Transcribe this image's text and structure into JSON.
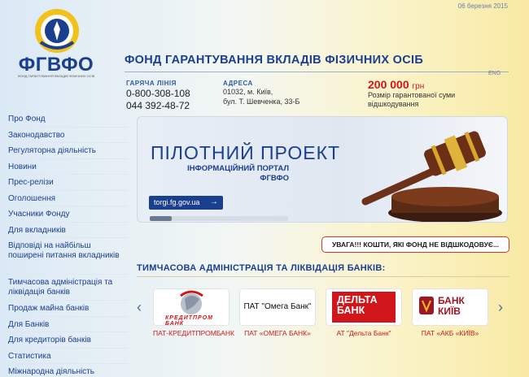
{
  "header": {
    "date": "06 березня 2015",
    "logo_text": "ФГВФО",
    "logo_subtext": "ФОНД ГАРАНТУВАННЯ ВКЛАДІВ ФІЗИЧНИХ ОСІБ",
    "site_title": "ФОНД ГАРАНТУВАННЯ ВКЛАДІВ ФІЗИЧНИХ ОСІБ",
    "lang_link": "ENG"
  },
  "contacts": {
    "hotline_label": "ГАРЯЧА ЛІНІЯ",
    "hotline_phone1": "0-800-308-108",
    "hotline_phone2": "044 392-48-72",
    "address_label": "АДРЕСА",
    "address_line1": "01032, м. Київ,",
    "address_line2": "бул. Т. Шевченка, 33-Б",
    "guarantee_amount": "200 000",
    "guarantee_currency": "грн",
    "guarantee_desc1": "Розмір гарантованої суми",
    "guarantee_desc2": "відшкодування"
  },
  "sidebar": {
    "items": [
      {
        "label": "Про Фонд"
      },
      {
        "label": "Законодавство"
      },
      {
        "label": "Регуляторна діяльність"
      },
      {
        "label": "Новини"
      },
      {
        "label": "Прес-релізи"
      },
      {
        "label": "Оголошення"
      },
      {
        "label": "Учасники Фонду"
      },
      {
        "label": "Для вкладників"
      },
      {
        "label": "Відповіді на найбільш поширені питання вкладників"
      },
      {
        "label": "Тимчасова адміністрація та ліквідація банків"
      },
      {
        "label": "Продаж майна банків"
      },
      {
        "label": "Для Банків"
      },
      {
        "label": "Для кредиторів банків"
      },
      {
        "label": "Статистика"
      },
      {
        "label": "Міжнародна діяльність"
      }
    ]
  },
  "banner": {
    "title": "ПІЛОТНИЙ ПРОЕКТ",
    "subtitle_line1": "ІНФОРМАЦІЙНИЙ ПОРТАЛ",
    "subtitle_line2": "ФГВФО",
    "link_label": "torgi.fg.gov.ua",
    "slide_progress": 0.16
  },
  "alert": {
    "text": "УВАГА!!! КОШТИ, ЯКІ ФОНД НЕ ВІДШКОДОВУЄ..."
  },
  "banks_section": {
    "title": "ТИМЧАСОВА АДМІНІСТРАЦІЯ ТА ЛІКВІДАЦІЯ БАНКІВ:",
    "prev_icon": "chevron-left-icon",
    "next_icon": "chevron-right-icon",
    "banks": [
      {
        "caption": "ПАТ-КРЕДИТПРОМБАНК",
        "logo_text": "КРЕДИТПРОМ БАНК"
      },
      {
        "caption": "ПАТ «ОМЕГА БАНК»",
        "logo_text": "ПАТ \"Омега Банк\""
      },
      {
        "caption": "АТ \"Дельта Банк\"",
        "logo_line1": "ДЕЛЬТА",
        "logo_line2": "БАНК"
      },
      {
        "caption": "ПАТ «АКБ «КИЇВ»",
        "logo_line1": "БАНК",
        "logo_line2": "КИЇВ"
      }
    ]
  },
  "colors": {
    "primary": "#1b3f8f",
    "accent_red": "#d1161b",
    "gold": "#f0c419"
  }
}
